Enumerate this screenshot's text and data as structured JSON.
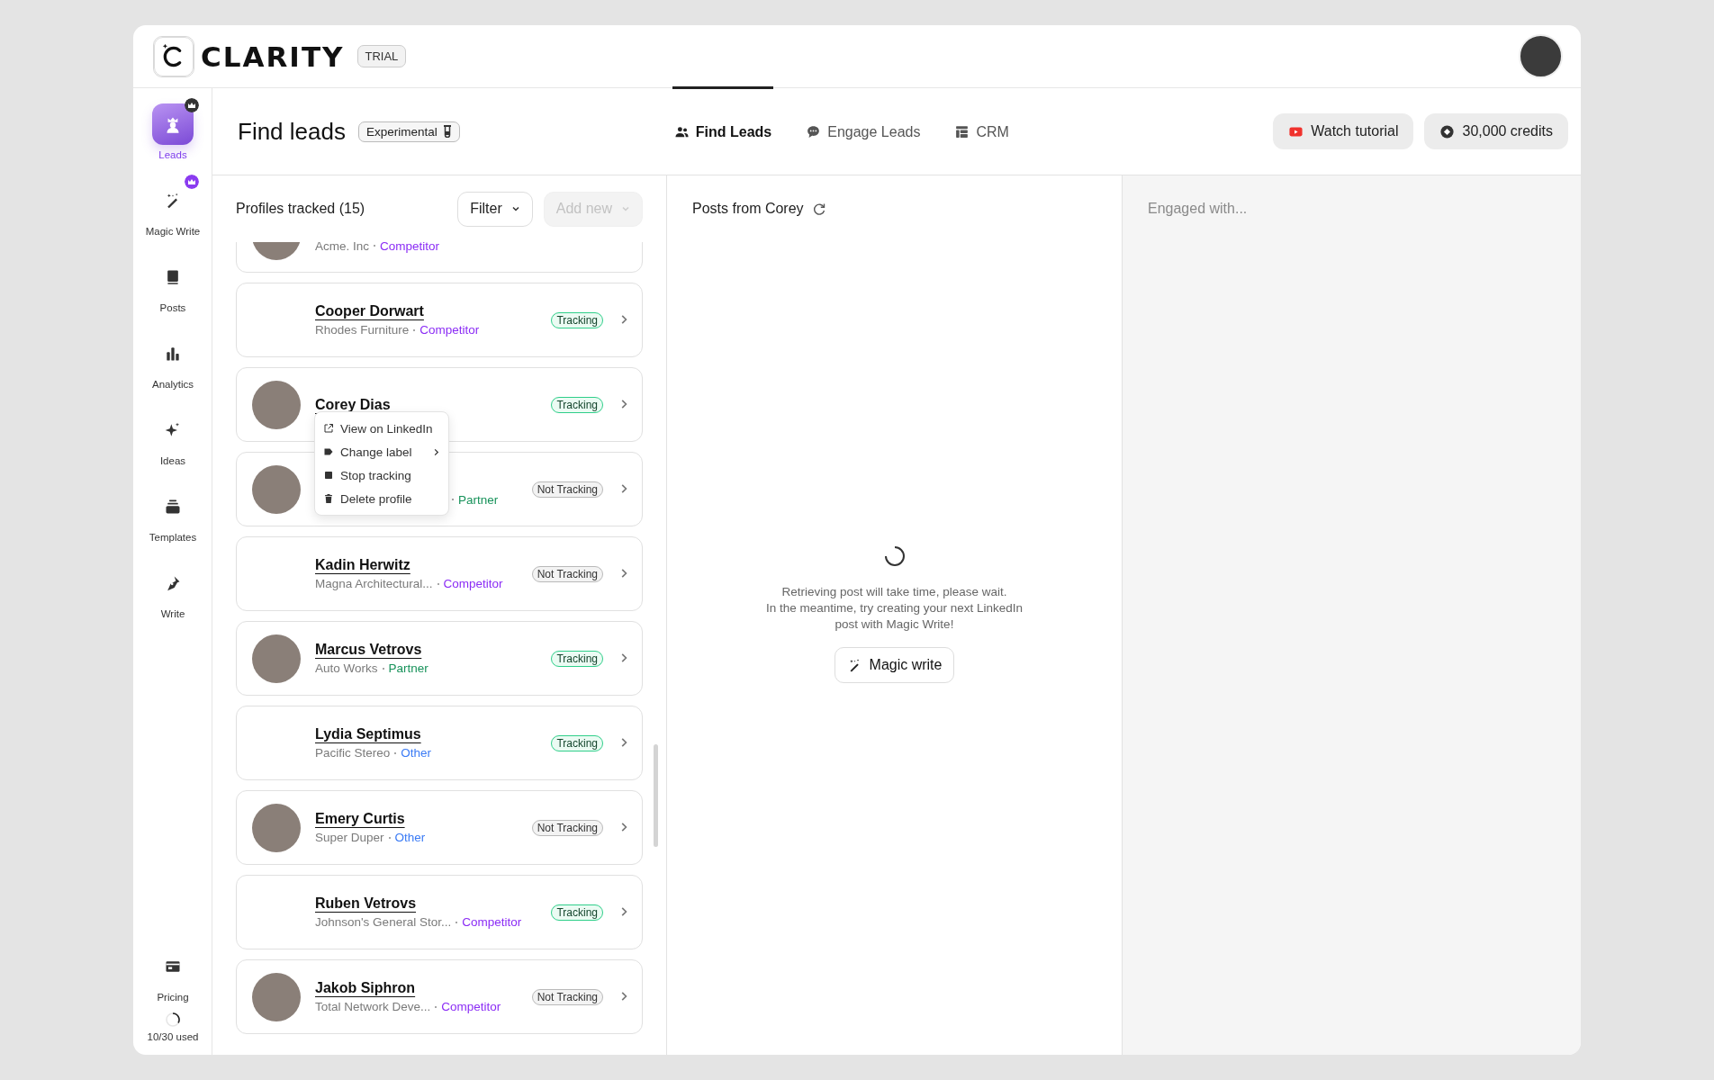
{
  "brand": {
    "name": "CLARITY",
    "badge": "TRIAL"
  },
  "sidebar": {
    "items": [
      {
        "label": "Leads",
        "kind": "leads",
        "selected": true,
        "premium": true
      },
      {
        "label": "Magic Write",
        "kind": "wand",
        "selected": false,
        "premium": true
      },
      {
        "label": "Posts",
        "kind": "posts",
        "selected": false,
        "premium": false
      },
      {
        "label": "Analytics",
        "kind": "analytics",
        "selected": false,
        "premium": false
      },
      {
        "label": "Ideas",
        "kind": "ideas",
        "selected": false,
        "premium": false
      },
      {
        "label": "Templates",
        "kind": "templates",
        "selected": false,
        "premium": false
      },
      {
        "label": "Write",
        "kind": "write",
        "selected": false,
        "premium": false
      }
    ],
    "bottom": [
      {
        "label": "Pricing",
        "kind": "card",
        "selected": false,
        "premium": false
      }
    ],
    "usage": {
      "label": "10/30 used"
    }
  },
  "page": {
    "title": "Find leads",
    "badge": "Experimental"
  },
  "tabs": [
    {
      "label": "Find Leads",
      "kind": "people",
      "selected": true
    },
    {
      "label": "Engage Leads",
      "kind": "chat",
      "selected": false
    },
    {
      "label": "CRM",
      "kind": "table",
      "selected": false
    }
  ],
  "actions": [
    {
      "label": "Watch tutorial",
      "kind": "video"
    },
    {
      "label": "30,000 credits",
      "kind": "coin"
    }
  ],
  "profiles": {
    "title": "Profiles tracked (15)",
    "filter": "Filter",
    "add": {
      "label": "Add new",
      "disabled": true
    },
    "items": [
      {
        "company": "Acme. Inc",
        "label": "Competitor",
        "color": "#8b2cf5",
        "photo": true,
        "menu_open": false
      },
      {
        "name": "Cooper Dorwart",
        "company": "Rhodes Furniture",
        "label": "Competitor",
        "color": "#8b2cf5",
        "status": "Tracking",
        "tracking": true,
        "photo": false,
        "menu_open": false
      },
      {
        "name": "Corey Dias",
        "status": "Tracking",
        "tracking": true,
        "photo": true,
        "menu_open": true
      },
      {
        "label": "Partner",
        "color": "#17925a",
        "status": "Not Tracking",
        "tracking": false,
        "photo": true,
        "menu_open": false
      },
      {
        "name": "Kadin Herwitz",
        "company": "Magna Architectural...",
        "label": "Competitor",
        "color": "#8b2cf5",
        "status": "Not Tracking",
        "tracking": false,
        "photo": false,
        "menu_open": false
      },
      {
        "name": "Marcus Vetrovs",
        "company": "Auto Works",
        "label": "Partner",
        "color": "#17925a",
        "status": "Tracking",
        "tracking": true,
        "photo": true,
        "menu_open": false
      },
      {
        "name": "Lydia Septimus",
        "company": "Pacific Stereo",
        "label": "Other",
        "color": "#3b7bf5",
        "status": "Tracking",
        "tracking": true,
        "photo": false,
        "menu_open": false
      },
      {
        "name": "Emery Curtis",
        "company": "Super Duper",
        "label": "Other",
        "color": "#3b7bf5",
        "status": "Not Tracking",
        "tracking": false,
        "photo": true,
        "menu_open": false
      },
      {
        "name": "Ruben Vetrovs",
        "company": "Johnson's General Stor...",
        "label": "Competitor",
        "color": "#8b2cf5",
        "status": "Tracking",
        "tracking": true,
        "photo": false,
        "menu_open": false
      },
      {
        "name": "Jakob Siphron",
        "company": "Total Network Deve...",
        "label": "Competitor",
        "color": "#8b2cf5",
        "status": "Not Tracking",
        "tracking": false,
        "photo": true,
        "menu_open": false
      }
    ]
  },
  "menu": {
    "items": [
      {
        "label": "View on LinkedIn",
        "kind": "external",
        "submenu": false
      },
      {
        "label": "Change label",
        "kind": "tag",
        "submenu": true
      },
      {
        "label": "Stop tracking",
        "kind": "stop",
        "submenu": false
      },
      {
        "label": "Delete profile",
        "kind": "trash",
        "submenu": false
      }
    ]
  },
  "posts": {
    "title": "Posts from Corey",
    "message": "Retrieving post will take time, please wait.\nIn the meantime, try creating your next LinkedIn\npost with Magic Write!",
    "button": "Magic write"
  },
  "engaged": {
    "title": "Engaged with..."
  }
}
